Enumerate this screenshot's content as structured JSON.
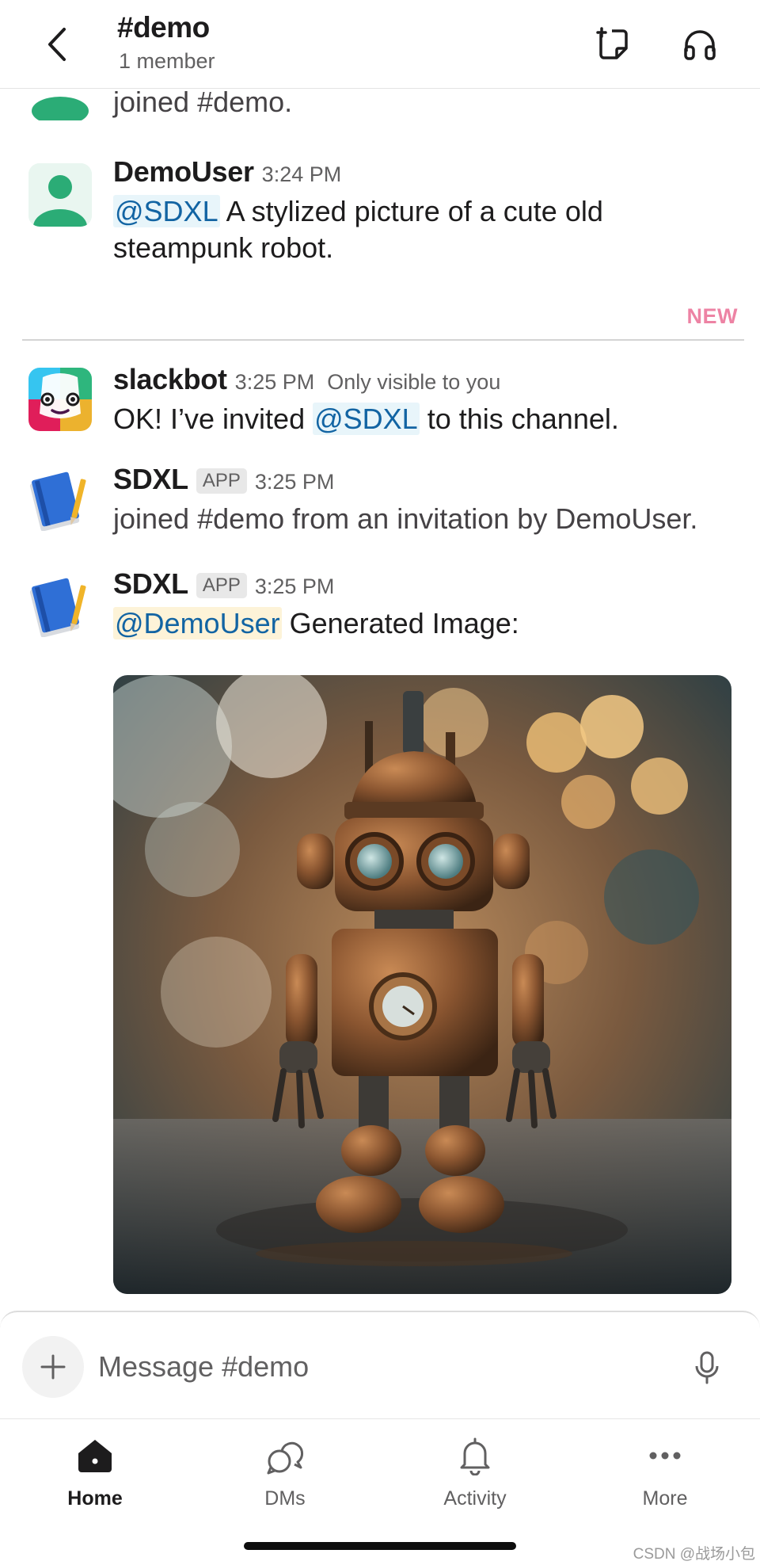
{
  "header": {
    "title": "#demo",
    "subtitle": "1 member"
  },
  "feed": {
    "prev_message_tail": "joined #demo.",
    "messages": [
      {
        "sender": "DemoUser",
        "time": "3:24 PM",
        "mention": "@SDXL",
        "text": " A stylized picture of a cute old steampunk robot."
      },
      {
        "sender": "slackbot",
        "time": "3:25 PM",
        "visibility": "Only visible to you",
        "text_before": "OK! I’ve invited ",
        "mention": "@SDXL",
        "text_after": " to this channel."
      },
      {
        "sender": "SDXL",
        "badge": "APP",
        "time": "3:25 PM",
        "text": "joined #demo from an invitation by DemoUser."
      },
      {
        "sender": "SDXL",
        "badge": "APP",
        "time": "3:25 PM",
        "mention": "@DemoUser",
        "text": " Generated Image:"
      }
    ],
    "new_divider_label": "NEW"
  },
  "composer": {
    "placeholder": "Message #demo"
  },
  "tabs": [
    {
      "label": "Home",
      "icon": "home-icon",
      "active": true
    },
    {
      "label": "DMs",
      "icon": "dms-icon",
      "active": false
    },
    {
      "label": "Activity",
      "icon": "bell-icon",
      "active": false
    },
    {
      "label": "More",
      "icon": "more-icon",
      "active": false
    }
  ],
  "watermark": "CSDN @战场小包",
  "colors": {
    "mention": "#1264a3",
    "new_label": "#e01e5a",
    "user_avatar": "#2bac76"
  }
}
